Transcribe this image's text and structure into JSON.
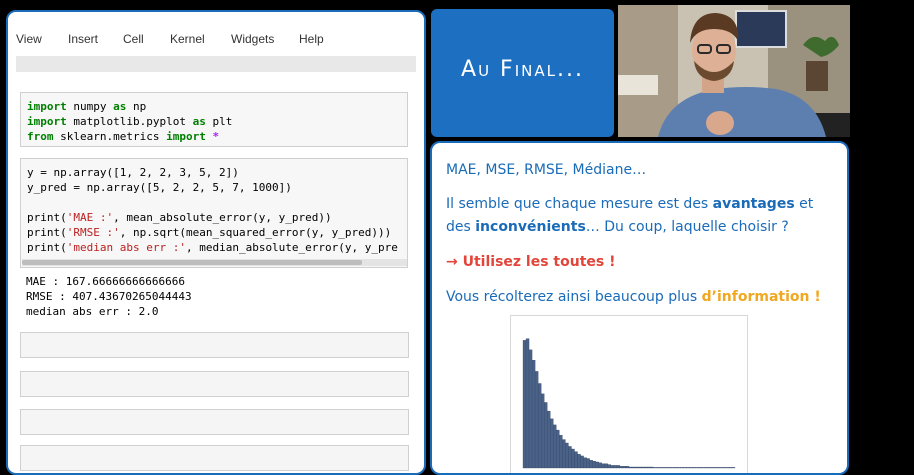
{
  "notebook": {
    "menu": [
      "View",
      "Insert",
      "Cell",
      "Kernel",
      "Widgets",
      "Help"
    ],
    "cell1": {
      "line1": {
        "kw1": "import",
        "rest1": " numpy ",
        "kw2": "as",
        "rest2": " np"
      },
      "line2": {
        "kw1": "import",
        "rest1": " matplotlib.pyplot ",
        "kw2": "as",
        "rest2": " plt"
      },
      "line3": {
        "kw1": "from",
        "rest1": " sklearn.metrics ",
        "kw2": "import",
        "rest2": " ",
        "op": "*"
      }
    },
    "cell2": {
      "line1": "y = np.array([1, 2, 2, 3, 5, 2])",
      "line2": "y_pred = np.array([5, 2, 2, 5, 7, 1000])",
      "line3a": "print(",
      "line3s": "'MAE :'",
      "line3b": ", mean_absolute_error(y, y_pred))",
      "line4a": "print(",
      "line4s": "'RMSE :'",
      "line4b": ", np.sqrt(mean_squared_error(y, y_pred)))",
      "line5a": "print(",
      "line5s": "'median abs err :'",
      "line5b": ", median_absolute_error(y, y_pre"
    },
    "output": {
      "line1": "MAE : 167.66666666666666",
      "line2": "RMSE : 407.43670265044443",
      "line3": "median abs err : 2.0"
    }
  },
  "banner": {
    "title": "Au Final..."
  },
  "slide": {
    "line1": "MAE, MSE, RMSE, Médiane…",
    "para2a": "Il semble que chaque mesure est des ",
    "para2b": "avantages",
    "para2c": " et",
    "para3a": "des ",
    "para3b": "inconvénients",
    "para3c": "… Du coup, laquelle choisir ?",
    "arrow": "→ ",
    "cta": "Utilisez les toutes !",
    "para5a": "Vous récolterez ainsi beaucoup plus ",
    "para5b": "d’information !"
  },
  "chart_data": {
    "type": "bar",
    "bins": [
      148,
      150,
      137,
      125,
      112,
      98,
      86,
      76,
      66,
      57,
      50,
      44,
      38,
      33,
      29,
      25,
      22,
      19,
      16,
      14,
      12,
      11,
      9,
      8,
      7,
      6,
      5,
      5,
      4,
      3,
      3,
      3,
      2,
      2,
      2,
      1,
      1,
      1,
      1,
      1,
      1,
      1,
      1,
      0,
      0,
      0,
      0,
      0,
      0,
      0,
      0,
      0,
      0,
      0,
      0,
      0,
      0,
      0,
      0,
      0,
      0,
      0,
      0,
      0,
      0,
      0,
      0,
      0,
      0,
      0
    ],
    "ymax": 160,
    "bar_color": "#4a6288"
  },
  "colors": {
    "accent": "#1a6bb8",
    "banner": "#1d6fc2",
    "orange": "#f0a820",
    "red": "#e2453a"
  }
}
